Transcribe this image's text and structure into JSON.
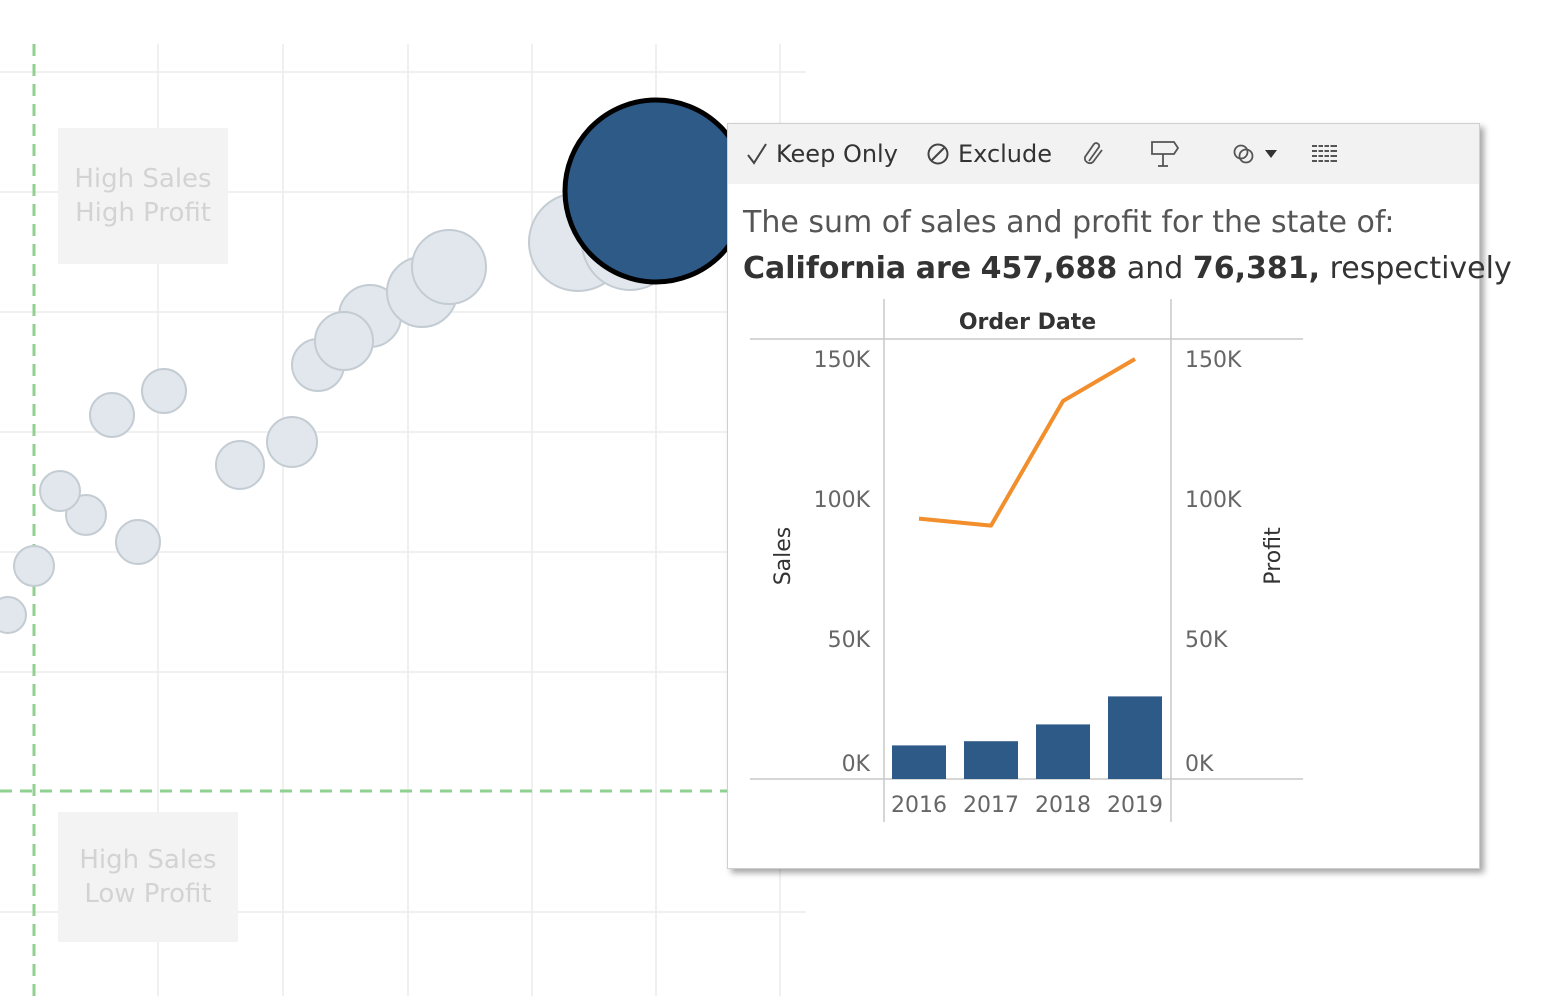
{
  "quadrants": {
    "high_sales_high_profit": [
      "High Sales",
      "High Profit"
    ],
    "high_sales_low_profit": [
      "High Sales",
      "Low Profit"
    ]
  },
  "scatter": {
    "selected_color": "#2e5a87",
    "bubble_color": "#e1e7ec",
    "reference_line_color": "#8fd28f"
  },
  "tooltip": {
    "toolbar": {
      "keep_only_label": "Keep Only",
      "exclude_label": "Exclude"
    },
    "text": {
      "line1": "The sum of sales and profit for the state of:",
      "state": "California",
      "are": "are",
      "sales": "457,688",
      "and": "and",
      "profit": "76,381,",
      "respectively": "respectively"
    }
  },
  "chart_data": {
    "type": "bar",
    "title": "Order Date",
    "categories": [
      "2016",
      "2017",
      "2018",
      "2019"
    ],
    "series": [
      {
        "name": "Sales",
        "chart": "bar",
        "axis": "left",
        "values": [
          12000,
          13500,
          19500,
          29500
        ],
        "color": "#2e5a87"
      },
      {
        "name": "Profit",
        "chart": "line",
        "axis": "right",
        "values": [
          93000,
          90500,
          135000,
          150000
        ],
        "color": "#f28e2b"
      }
    ],
    "ylabel": "Sales",
    "y2label": "Profit",
    "ylim": [
      0,
      160000
    ],
    "yticks": [
      "0K",
      "50K",
      "100K",
      "150K"
    ],
    "y2ticks": [
      "0K",
      "50K",
      "100K",
      "150K"
    ],
    "grid": false
  }
}
